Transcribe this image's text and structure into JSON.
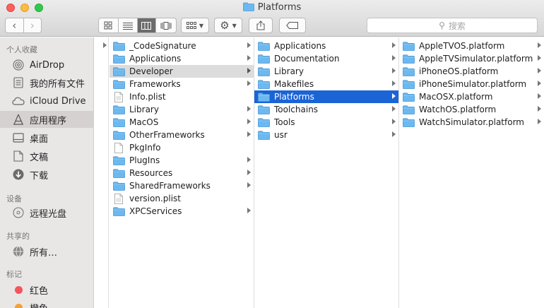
{
  "window": {
    "title": "Platforms"
  },
  "toolbar": {
    "back_icon": "chevron-left-icon",
    "forward_icon": "chevron-right-icon",
    "view_modes": [
      "icon-view",
      "list-view",
      "column-view",
      "cover-flow-view"
    ],
    "active_view": "column-view",
    "search_placeholder": "搜索"
  },
  "sidebar": {
    "sections": [
      {
        "header": "个人收藏",
        "items": [
          {
            "label": "AirDrop",
            "icon": "airdrop-icon"
          },
          {
            "label": "我的所有文件",
            "icon": "all-files-icon"
          },
          {
            "label": "iCloud Drive",
            "icon": "cloud-icon"
          },
          {
            "label": "应用程序",
            "icon": "applications-icon",
            "selected": true
          },
          {
            "label": "桌面",
            "icon": "desktop-icon"
          },
          {
            "label": "文稿",
            "icon": "documents-icon"
          },
          {
            "label": "下载",
            "icon": "downloads-icon"
          }
        ]
      },
      {
        "header": "设备",
        "items": [
          {
            "label": "远程光盘",
            "icon": "disc-icon"
          }
        ]
      },
      {
        "header": "共享的",
        "items": [
          {
            "label": "所有…",
            "icon": "network-icon"
          }
        ]
      },
      {
        "header": "标记",
        "items": [
          {
            "label": "红色",
            "icon": "tag-red-icon",
            "color": "#f2555a"
          },
          {
            "label": "橙色",
            "icon": "tag-orange-icon",
            "color": "#f6a034"
          }
        ]
      }
    ]
  },
  "columns": [
    {
      "items": [
        {
          "label": "_CodeSignature",
          "kind": "folder",
          "arrow": true
        },
        {
          "label": "Applications",
          "kind": "folder",
          "arrow": true
        },
        {
          "label": "Developer",
          "kind": "folder",
          "arrow": true,
          "state": "gray"
        },
        {
          "label": "Frameworks",
          "kind": "folder",
          "arrow": true
        },
        {
          "label": "Info.plist",
          "kind": "plist",
          "arrow": false
        },
        {
          "label": "Library",
          "kind": "folder",
          "arrow": true
        },
        {
          "label": "MacOS",
          "kind": "folder",
          "arrow": true
        },
        {
          "label": "OtherFrameworks",
          "kind": "folder",
          "arrow": true
        },
        {
          "label": "PkgInfo",
          "kind": "file",
          "arrow": false
        },
        {
          "label": "PlugIns",
          "kind": "folder",
          "arrow": true
        },
        {
          "label": "Resources",
          "kind": "folder",
          "arrow": true
        },
        {
          "label": "SharedFrameworks",
          "kind": "folder",
          "arrow": true
        },
        {
          "label": "version.plist",
          "kind": "plist",
          "arrow": false
        },
        {
          "label": "XPCServices",
          "kind": "folder",
          "arrow": true
        }
      ]
    },
    {
      "items": [
        {
          "label": "Applications",
          "kind": "folder",
          "arrow": true
        },
        {
          "label": "Documentation",
          "kind": "folder",
          "arrow": true
        },
        {
          "label": "Library",
          "kind": "folder",
          "arrow": true
        },
        {
          "label": "Makefiles",
          "kind": "folder",
          "arrow": true
        },
        {
          "label": "Platforms",
          "kind": "folder",
          "arrow": true,
          "state": "blue"
        },
        {
          "label": "Toolchains",
          "kind": "folder",
          "arrow": true
        },
        {
          "label": "Tools",
          "kind": "folder",
          "arrow": true
        },
        {
          "label": "usr",
          "kind": "folder",
          "arrow": true
        }
      ]
    },
    {
      "items": [
        {
          "label": "AppleTVOS.platform",
          "kind": "folder",
          "arrow": true
        },
        {
          "label": "AppleTVSimulator.platform",
          "kind": "folder",
          "arrow": true
        },
        {
          "label": "iPhoneOS.platform",
          "kind": "folder",
          "arrow": true
        },
        {
          "label": "iPhoneSimulator.platform",
          "kind": "folder",
          "arrow": true
        },
        {
          "label": "MacOSX.platform",
          "kind": "folder",
          "arrow": true
        },
        {
          "label": "WatchOS.platform",
          "kind": "folder",
          "arrow": true
        },
        {
          "label": "WatchSimulator.platform",
          "kind": "folder",
          "arrow": true
        }
      ]
    }
  ],
  "colors": {
    "selection_blue": "#1b64d6",
    "folder_blue": "#6cb8ef",
    "sidebar_bg": "#e9e6e6"
  }
}
